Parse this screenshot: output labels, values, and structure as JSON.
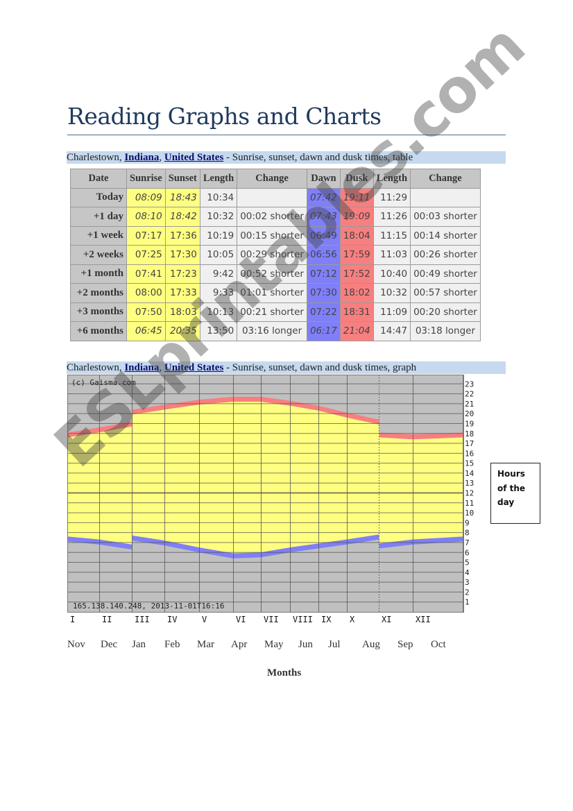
{
  "page": {
    "title": "Reading Graphs and Charts",
    "watermark": "ESLprintables.com"
  },
  "table_caption": {
    "city": "Charlestown, ",
    "state_link": "Indiana",
    "comma": ", ",
    "country_link": "United States",
    "rest": " - Sunrise, sunset, dawn and dusk times, table"
  },
  "graph_caption": {
    "city": "Charlestown, ",
    "state_link": "Indiana",
    "comma": ", ",
    "country_link": "United States",
    "rest": " - Sunrise, sunset, dawn and dusk times, graph"
  },
  "table": {
    "headers": [
      "Date",
      "Sunrise",
      "Sunset",
      "Length",
      "Change",
      "Dawn",
      "Dusk",
      "Length",
      "Change"
    ],
    "rows": [
      {
        "date": "Today",
        "sunrise": "08:09",
        "sunset": "18:43",
        "length": "10:34",
        "change": "",
        "dawn": "07:42",
        "dusk": "19:11",
        "length2": "11:29",
        "change2": "",
        "italic": true
      },
      {
        "date": "+1 day",
        "sunrise": "08:10",
        "sunset": "18:42",
        "length": "10:32",
        "change": "00:02 shorter",
        "dawn": "07:43",
        "dusk": "19:09",
        "length2": "11:26",
        "change2": "00:03 shorter",
        "italic": true
      },
      {
        "date": "+1 week",
        "sunrise": "07:17",
        "sunset": "17:36",
        "length": "10:19",
        "change": "00:15 shorter",
        "dawn": "06:49",
        "dusk": "18:04",
        "length2": "11:15",
        "change2": "00:14 shorter",
        "italic": false
      },
      {
        "date": "+2 weeks",
        "sunrise": "07:25",
        "sunset": "17:30",
        "length": "10:05",
        "change": "00:29 shorter",
        "dawn": "06:56",
        "dusk": "17:59",
        "length2": "11:03",
        "change2": "00:26 shorter",
        "italic": false
      },
      {
        "date": "+1 month",
        "sunrise": "07:41",
        "sunset": "17:23",
        "length": "9:42",
        "change": "00:52 shorter",
        "dawn": "07:12",
        "dusk": "17:52",
        "length2": "10:40",
        "change2": "00:49 shorter",
        "italic": false
      },
      {
        "date": "+2 months",
        "sunrise": "08:00",
        "sunset": "17:33",
        "length": "9:33",
        "change": "01:01 shorter",
        "dawn": "07:30",
        "dusk": "18:02",
        "length2": "10:32",
        "change2": "00:57 shorter",
        "italic": false
      },
      {
        "date": "+3 months",
        "sunrise": "07:50",
        "sunset": "18:03",
        "length": "10:13",
        "change": "00:21 shorter",
        "dawn": "07:22",
        "dusk": "18:31",
        "length2": "11:09",
        "change2": "00:20 shorter",
        "italic": false
      },
      {
        "date": "+6 months",
        "sunrise": "06:45",
        "sunset": "20:35",
        "length": "13:50",
        "change": "03:16 longer",
        "dawn": "06:17",
        "dusk": "21:04",
        "length2": "14:47",
        "change2": "03:18 longer",
        "italic": true
      }
    ]
  },
  "colors": {
    "day": "#fefe80",
    "night": "#c0c0c0",
    "dawn_band": "#7f7ff8",
    "dusk_band": "#f87f7f",
    "grid": "#555555"
  },
  "chart_data": {
    "type": "area",
    "title": "Charlestown, Indiana, United States - Sunrise, sunset, dawn and dusk times, graph",
    "copyright": "(c) Gaisma.com",
    "footer_stamp": "165.138.140.248, 2013-11-01T16:16",
    "xlabel": "Months",
    "ylabel": "Hours of the day",
    "ylim": [
      0,
      24
    ],
    "y_ticks": [
      1,
      2,
      3,
      4,
      5,
      6,
      7,
      8,
      9,
      10,
      11,
      12,
      13,
      14,
      15,
      16,
      17,
      18,
      19,
      20,
      21,
      22,
      23
    ],
    "roman_ticks": [
      "I",
      "II",
      "III",
      "IV",
      "V",
      "VI",
      "VII",
      "VIII",
      "IX",
      "X",
      "XI",
      "XII"
    ],
    "month_labels": [
      "Nov",
      "Dec",
      "Jan",
      "Feb",
      "Mar",
      "Apr",
      "May",
      "Jun",
      "Jul",
      "Aug",
      "Sep",
      "Oct"
    ],
    "grid": true,
    "x_month_fraction": [
      0,
      1,
      2,
      2,
      3,
      4,
      5,
      6,
      7,
      8,
      9,
      10,
      10,
      11,
      12
    ],
    "series": [
      {
        "name": "Sunset",
        "values": [
          17.6,
          18.1,
          18.7,
          19.9,
          20.4,
          20.9,
          21.2,
          21.2,
          20.8,
          20.3,
          19.6,
          18.9,
          17.6,
          17.4,
          17.6
        ]
      },
      {
        "name": "Dusk",
        "values": [
          18.1,
          18.6,
          19.2,
          20.4,
          20.9,
          21.4,
          21.7,
          21.7,
          21.3,
          20.8,
          20.1,
          19.4,
          18.1,
          17.9,
          18.1
        ]
      },
      {
        "name": "Sunrise",
        "values": [
          7.6,
          7.3,
          6.8,
          7.7,
          7.2,
          6.5,
          5.9,
          6.0,
          6.5,
          6.9,
          7.3,
          7.8,
          6.9,
          7.3,
          7.6
        ]
      },
      {
        "name": "Dawn",
        "values": [
          7.1,
          6.8,
          6.3,
          7.2,
          6.7,
          6.0,
          5.4,
          5.5,
          6.0,
          6.4,
          6.8,
          7.3,
          6.4,
          6.8,
          7.1
        ]
      }
    ]
  },
  "legend_box": {
    "text": "Hours of the day"
  }
}
